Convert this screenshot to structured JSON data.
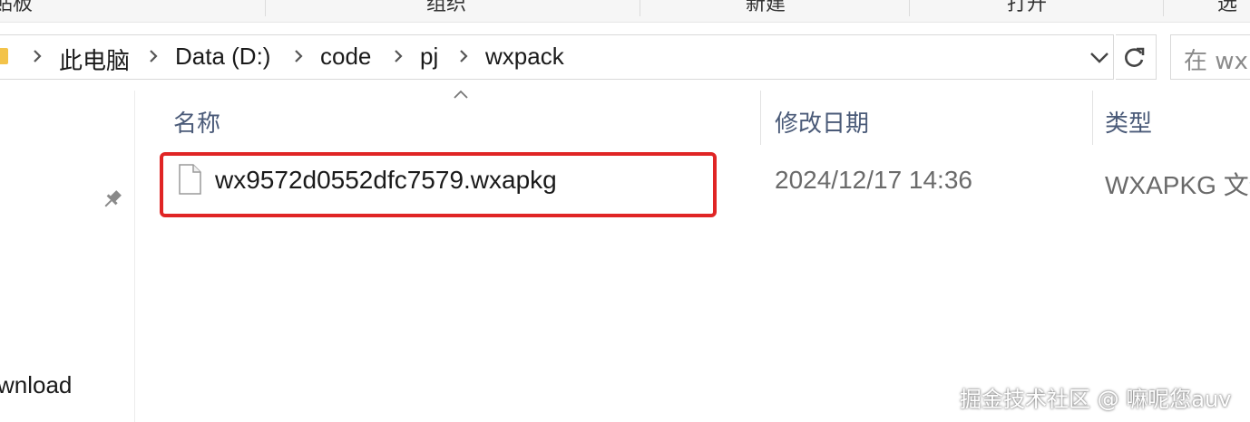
{
  "ribbon": {
    "groups": [
      "剪贴板",
      "组织",
      "新建",
      "打开",
      "选"
    ]
  },
  "address": {
    "breadcrumb": [
      "此电脑",
      "Data (D:)",
      "code",
      "pj",
      "wxpack"
    ],
    "search_placeholder": "在 wx"
  },
  "nav": {
    "items": [
      "wnload"
    ]
  },
  "columns": {
    "name": "名称",
    "modified": "修改日期",
    "type": "类型"
  },
  "files": [
    {
      "name": "wx9572d0552dfc7579.wxapkg",
      "modified": "2024/12/17 14:36",
      "type": "WXAPKG 文件",
      "highlighted": true
    }
  ],
  "watermark": "掘金技术社区 @ 嘛呢您auv",
  "colors": {
    "highlight_border": "#e02525",
    "header_text": "#4a5a78",
    "folder": "#f3c34a"
  },
  "icons": [
    "folder-icon",
    "chevron-right-icon",
    "chevron-down-icon",
    "refresh-icon",
    "pin-icon",
    "sort-up-icon",
    "file-icon"
  ]
}
